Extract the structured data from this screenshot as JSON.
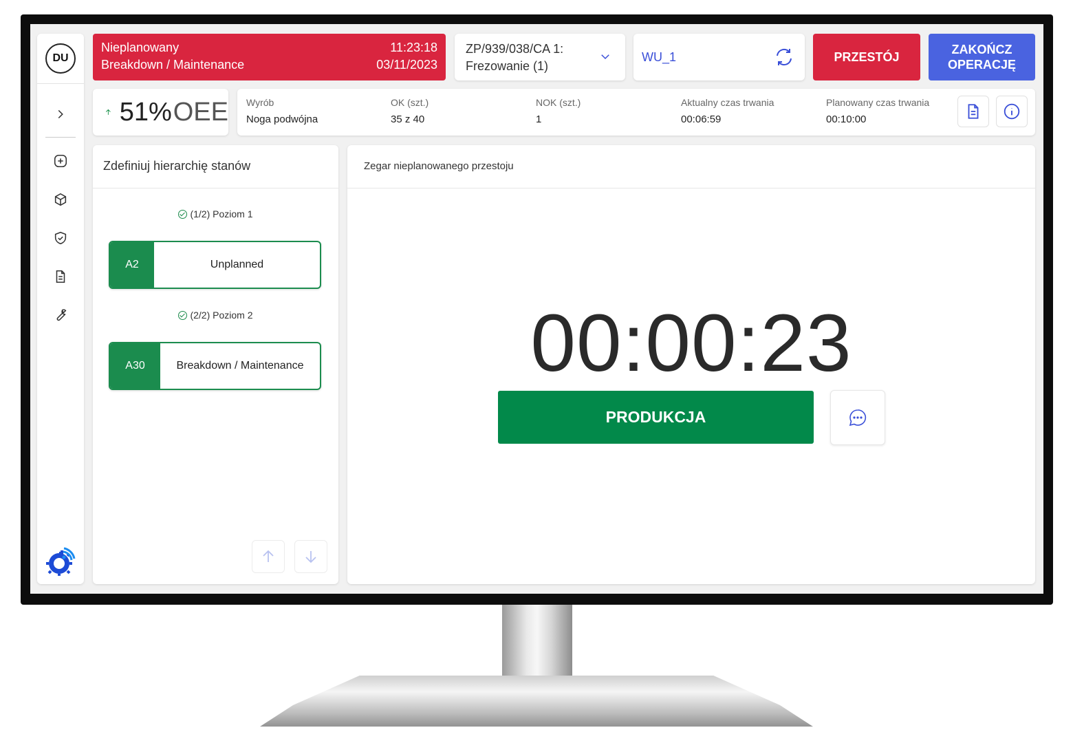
{
  "user": {
    "initials": "DU"
  },
  "status": {
    "type": "Nieplanowany",
    "reason": "Breakdown / Maintenance",
    "time": "11:23:18",
    "date": "03/11/2023",
    "color": "#d9253f"
  },
  "order": {
    "line1": "ZP/939/038/CA 1:",
    "line2": "Frezowanie (1)"
  },
  "workunit": {
    "name": "WU_1"
  },
  "buttons": {
    "przestoj": "PRZESTÓJ",
    "zakoncz": "ZAKOŃCZ\nOPERACJĘ",
    "produkcja": "PRODUKCJA"
  },
  "oee": {
    "value": "51%",
    "label": "OEE",
    "trend": "up"
  },
  "info": {
    "wyrob_label": "Wyrób",
    "wyrob_value": "Noga podwójna",
    "ok_label": "OK (szt.)",
    "ok_value": "35 z 40",
    "nok_label": "NOK (szt.)",
    "nok_value": "1",
    "actual_label": "Aktualny czas trwania",
    "actual_value": "00:06:59",
    "planned_label": "Planowany czas trwania",
    "planned_value": "00:10:00"
  },
  "hierarchy": {
    "title": "Zdefiniuj hierarchię stanów",
    "levels": [
      {
        "label": "(1/2) Poziom 1",
        "code": "A2",
        "name": "Unplanned"
      },
      {
        "label": "(2/2) Poziom 2",
        "code": "A30",
        "name": "Breakdown / Maintenance"
      }
    ]
  },
  "clock": {
    "title": "Zegar nieplanowanego przestoju",
    "time": "00:00:23"
  },
  "colors": {
    "accent": "#4a63e0",
    "danger": "#d9253f",
    "success": "#02894a"
  }
}
